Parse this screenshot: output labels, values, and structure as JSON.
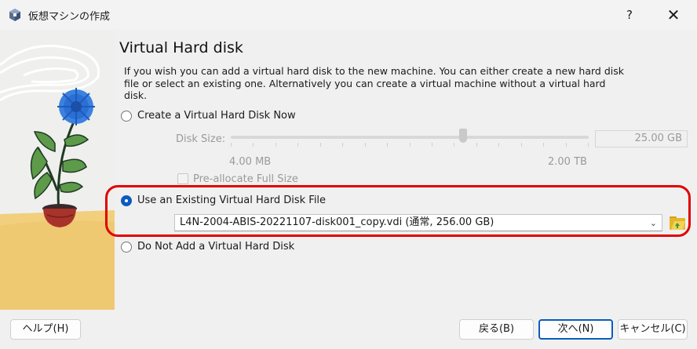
{
  "window": {
    "title": "仮想マシンの作成",
    "help_glyph": "?",
    "close_glyph": "✕",
    "app_icon": "virtualbox-cube-icon"
  },
  "page": {
    "heading": "Virtual Hard disk",
    "description": "If you wish you can add a virtual hard disk to the new machine. You can either create a new hard disk file or select an existing one. Alternatively you can create a virtual machine without a virtual hard disk."
  },
  "options": {
    "create_new": {
      "label": "Create a Virtual Hard Disk Now",
      "checked": false
    },
    "disk_size": {
      "label": "Disk Size:",
      "value": "25.00 GB",
      "min_label": "4.00 MB",
      "max_label": "2.00 TB",
      "enabled": false,
      "slider_level": 0.65
    },
    "preallocate": {
      "label": "Pre-allocate Full Size",
      "checked": false,
      "enabled": false
    },
    "use_existing": {
      "label": "Use an Existing Virtual Hard Disk File",
      "checked": true,
      "selected_file": "L4N-2004-ABIS-20221107-disk001_copy.vdi (通常, 256.00 GB)",
      "browse_icon": "folder-open-icon"
    },
    "no_disk": {
      "label": "Do Not Add a Virtual Hard Disk",
      "checked": false
    }
  },
  "buttons": {
    "help": "ヘルプ(H)",
    "back": "戻る(B)",
    "next": "次へ(N)",
    "cancel": "キャンセル(C)"
  },
  "colors": {
    "accent": "#0b5cbf",
    "highlight": "#e00000"
  }
}
